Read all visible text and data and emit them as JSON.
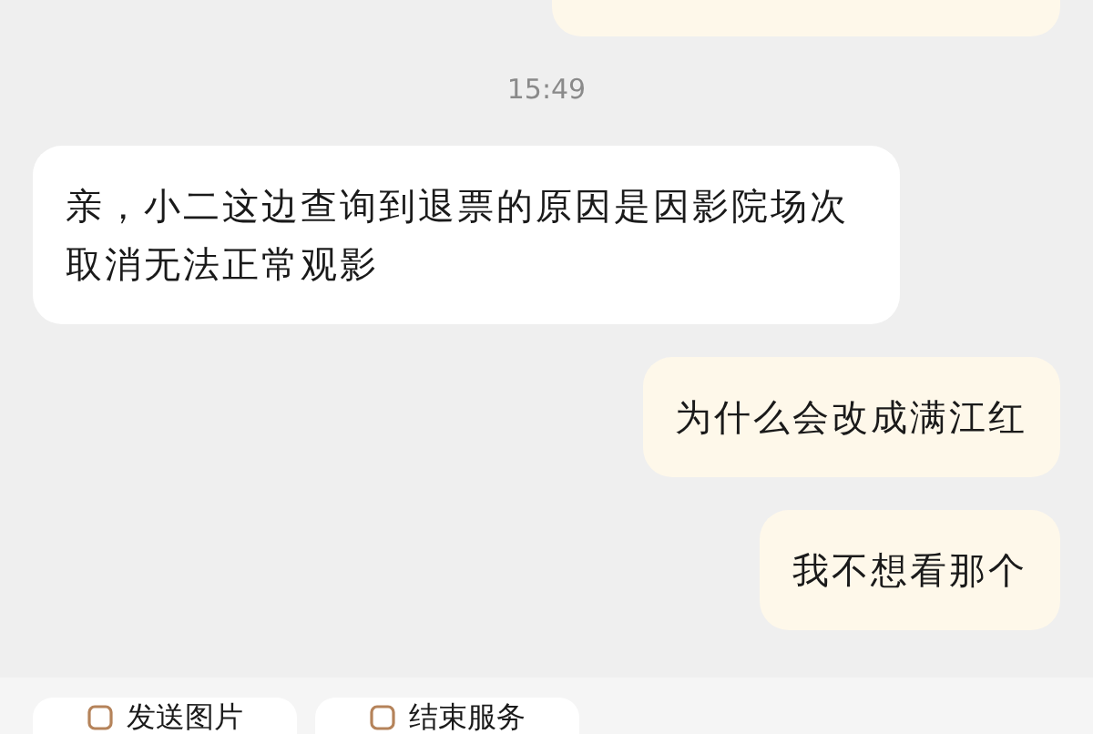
{
  "time_divider": "15:49",
  "messages": [
    {
      "kind": "incoming",
      "text": "亲，小二这边查询到退票的原因是因影院场次取消无法正常观影"
    },
    {
      "kind": "outgoing",
      "text": "为什么会改成满江红"
    },
    {
      "kind": "outgoing",
      "text": "我不想看那个"
    }
  ],
  "quick_actions": [
    "发送图片",
    "结束服务"
  ]
}
